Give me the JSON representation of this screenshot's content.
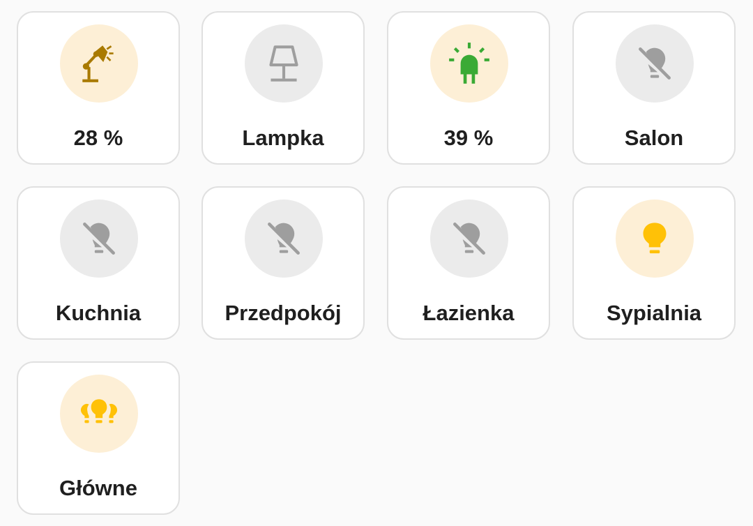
{
  "tiles": [
    {
      "label": "28 %",
      "icon": "desk-lamp-icon",
      "state": "on",
      "color": "#a97a00"
    },
    {
      "label": "Lampka",
      "icon": "floor-lamp-icon",
      "state": "off",
      "color": "#9e9e9e"
    },
    {
      "label": "39 %",
      "icon": "led-icon",
      "state": "on",
      "color": "#3aaa35"
    },
    {
      "label": "Salon",
      "icon": "lightbulb-off-icon",
      "state": "off",
      "color": "#9e9e9e"
    },
    {
      "label": "Kuchnia",
      "icon": "lightbulb-off-icon",
      "state": "off",
      "color": "#9e9e9e"
    },
    {
      "label": "Przedpokój",
      "icon": "lightbulb-off-icon",
      "state": "off",
      "color": "#9e9e9e"
    },
    {
      "label": "Łazienka",
      "icon": "lightbulb-off-icon",
      "state": "off",
      "color": "#9e9e9e"
    },
    {
      "label": "Sypialnia",
      "icon": "lightbulb-icon",
      "state": "on",
      "color": "#ffc107"
    },
    {
      "label": "Główne",
      "icon": "lightbulb-group-icon",
      "state": "on",
      "color": "#ffc107"
    }
  ]
}
